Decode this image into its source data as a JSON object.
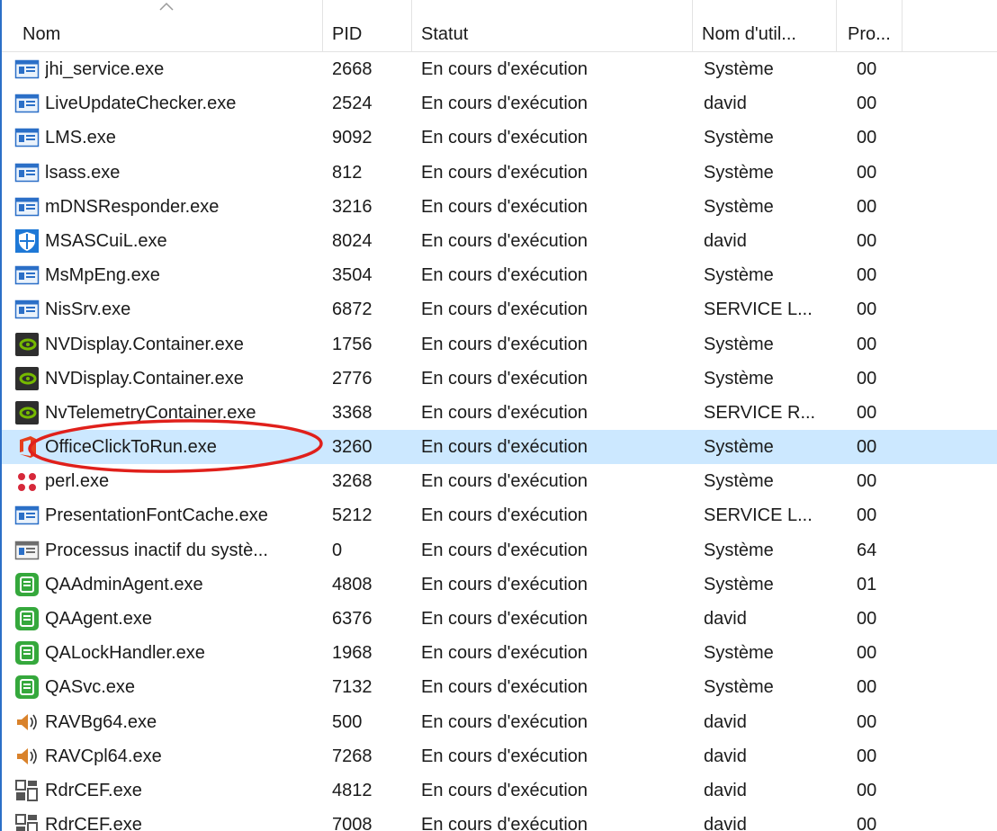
{
  "columns": {
    "name": "Nom",
    "pid": "PID",
    "status": "Statut",
    "user": "Nom d'util...",
    "cpu": "Pro..."
  },
  "selected_index": 11,
  "processes": [
    {
      "name": "jhi_service.exe",
      "pid": "2668",
      "status": "En cours d'exécution",
      "user": "Système",
      "cpu": "00",
      "icon": "service-window-icon"
    },
    {
      "name": "LiveUpdateChecker.exe",
      "pid": "2524",
      "status": "En cours d'exécution",
      "user": "david",
      "cpu": "00",
      "icon": "service-window-icon"
    },
    {
      "name": "LMS.exe",
      "pid": "9092",
      "status": "En cours d'exécution",
      "user": "Système",
      "cpu": "00",
      "icon": "service-window-icon"
    },
    {
      "name": "lsass.exe",
      "pid": "812",
      "status": "En cours d'exécution",
      "user": "Système",
      "cpu": "00",
      "icon": "service-window-icon"
    },
    {
      "name": "mDNSResponder.exe",
      "pid": "3216",
      "status": "En cours d'exécution",
      "user": "Système",
      "cpu": "00",
      "icon": "service-window-icon"
    },
    {
      "name": "MSASCuiL.exe",
      "pid": "8024",
      "status": "En cours d'exécution",
      "user": "david",
      "cpu": "00",
      "icon": "defender-shield-icon"
    },
    {
      "name": "MsMpEng.exe",
      "pid": "3504",
      "status": "En cours d'exécution",
      "user": "Système",
      "cpu": "00",
      "icon": "service-window-icon"
    },
    {
      "name": "NisSrv.exe",
      "pid": "6872",
      "status": "En cours d'exécution",
      "user": "SERVICE L...",
      "cpu": "00",
      "icon": "service-window-icon"
    },
    {
      "name": "NVDisplay.Container.exe",
      "pid": "1756",
      "status": "En cours d'exécution",
      "user": "Système",
      "cpu": "00",
      "icon": "nvidia-icon"
    },
    {
      "name": "NVDisplay.Container.exe",
      "pid": "2776",
      "status": "En cours d'exécution",
      "user": "Système",
      "cpu": "00",
      "icon": "nvidia-icon"
    },
    {
      "name": "NvTelemetryContainer.exe",
      "pid": "3368",
      "status": "En cours d'exécution",
      "user": "SERVICE R...",
      "cpu": "00",
      "icon": "nvidia-icon"
    },
    {
      "name": "OfficeClickToRun.exe",
      "pid": "3260",
      "status": "En cours d'exécution",
      "user": "Système",
      "cpu": "00",
      "icon": "office-icon"
    },
    {
      "name": "perl.exe",
      "pid": "3268",
      "status": "En cours d'exécution",
      "user": "Système",
      "cpu": "00",
      "icon": "perl-dots-icon"
    },
    {
      "name": "PresentationFontCache.exe",
      "pid": "5212",
      "status": "En cours d'exécution",
      "user": "SERVICE L...",
      "cpu": "00",
      "icon": "service-window-icon"
    },
    {
      "name": "Processus inactif du systè...",
      "pid": "0",
      "status": "En cours d'exécution",
      "user": "Système",
      "cpu": "64",
      "icon": "system-idle-icon"
    },
    {
      "name": "QAAdminAgent.exe",
      "pid": "4808",
      "status": "En cours d'exécution",
      "user": "Système",
      "cpu": "01",
      "icon": "qa-green-icon"
    },
    {
      "name": "QAAgent.exe",
      "pid": "6376",
      "status": "En cours d'exécution",
      "user": "david",
      "cpu": "00",
      "icon": "qa-green-icon"
    },
    {
      "name": "QALockHandler.exe",
      "pid": "1968",
      "status": "En cours d'exécution",
      "user": "Système",
      "cpu": "00",
      "icon": "qa-green-icon"
    },
    {
      "name": "QASvc.exe",
      "pid": "7132",
      "status": "En cours d'exécution",
      "user": "Système",
      "cpu": "00",
      "icon": "qa-green-icon"
    },
    {
      "name": "RAVBg64.exe",
      "pid": "500",
      "status": "En cours d'exécution",
      "user": "david",
      "cpu": "00",
      "icon": "speaker-icon"
    },
    {
      "name": "RAVCpl64.exe",
      "pid": "7268",
      "status": "En cours d'exécution",
      "user": "david",
      "cpu": "00",
      "icon": "speaker-icon"
    },
    {
      "name": "RdrCEF.exe",
      "pid": "4812",
      "status": "En cours d'exécution",
      "user": "david",
      "cpu": "00",
      "icon": "grid-app-icon"
    },
    {
      "name": "RdrCEF.exe",
      "pid": "7008",
      "status": "En cours d'exécution",
      "user": "david",
      "cpu": "00",
      "icon": "grid-app-icon"
    }
  ],
  "colors": {
    "selection": "#cce8ff",
    "annotation": "#e0201b",
    "accent": "#2b6fc7"
  }
}
